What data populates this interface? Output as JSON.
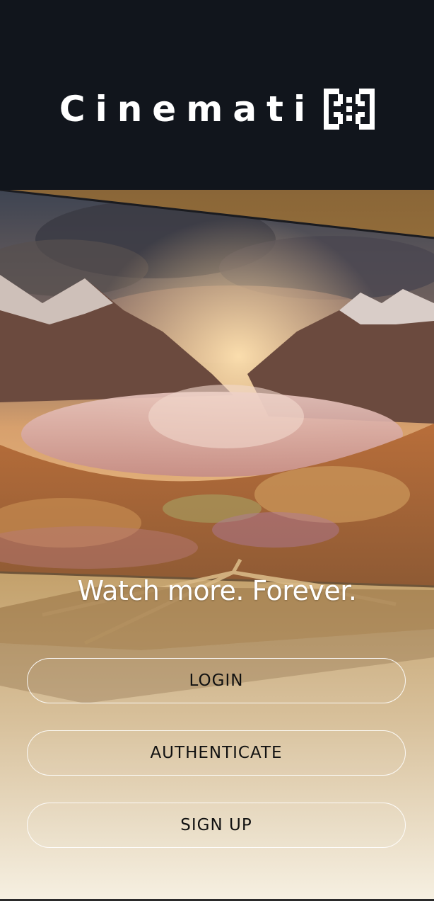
{
  "app": {
    "logo_text": "Cinemati",
    "logo_mark_icon": "cinematic-x-mark-icon"
  },
  "hero": {
    "tagline": "Watch more. Forever.",
    "image": "tv-mountain-landscape-illustration"
  },
  "actions": {
    "login_label": "LOGIN",
    "authenticate_label": "AUTHENTICATE",
    "signup_label": "SIGN UP"
  },
  "colors": {
    "background_dark": "#11151c",
    "accent_gold": "#b88a4a",
    "button_border": "#ffffff"
  }
}
